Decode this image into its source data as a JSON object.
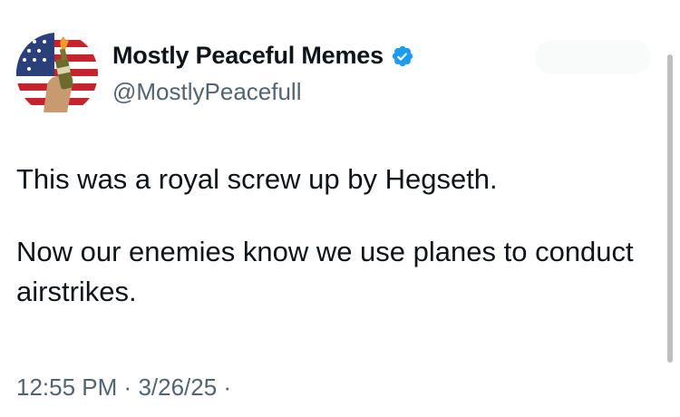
{
  "tweet": {
    "display_name": "Mostly Peaceful Memes",
    "handle": "@MostlyPeacefull",
    "verified": true,
    "text_paragraphs": [
      "This was a royal screw up by Hegseth.",
      "Now our enemies know we use planes to conduct airstrikes."
    ],
    "time": "12:55 PM",
    "separator": "·",
    "date": "3/26/25",
    "trailing_separator": "·"
  },
  "icons": {
    "avatar": "avatar-flag-molotov",
    "verified": "verified-badge-icon"
  },
  "colors": {
    "text": "#0f1419",
    "secondary": "#536471",
    "verified": "#1d9bf0",
    "background": "#ffffff"
  }
}
